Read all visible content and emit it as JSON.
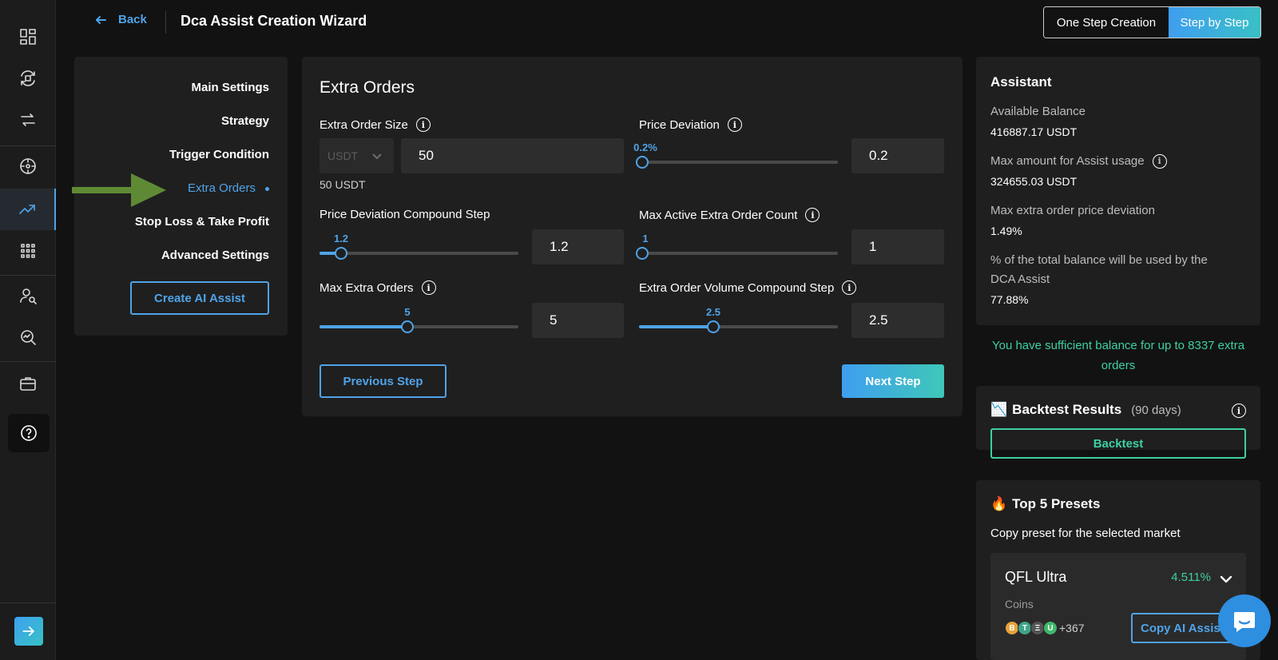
{
  "header": {
    "back_label": "Back",
    "title": "Dca Assist Creation Wizard",
    "mode_one": "One Step Creation",
    "mode_step": "Step by Step"
  },
  "rail": {
    "icons": [
      "dashboard-icon",
      "bots-cycle-icon",
      "swap-icon",
      "target-icon",
      "trending-icon",
      "grid-apps-icon",
      "user-search-icon",
      "analytics-search-icon",
      "briefcase-icon",
      "help-icon",
      "expand-arrow-icon"
    ]
  },
  "steps": {
    "items": [
      {
        "label": "Main Settings"
      },
      {
        "label": "Strategy"
      },
      {
        "label": "Trigger Condition"
      },
      {
        "label": "Extra Orders"
      },
      {
        "label": "Stop Loss & Take Profit"
      },
      {
        "label": "Advanced Settings"
      }
    ],
    "active_index": 3,
    "create_ai_label": "Create AI Assist"
  },
  "form": {
    "heading": "Extra Orders",
    "extra_order_size": {
      "label": "Extra Order Size",
      "currency": "USDT",
      "value": "50",
      "sub": "50 USDT"
    },
    "price_deviation": {
      "label": "Price Deviation",
      "slider_label": "0.2%",
      "value": "0.2",
      "fraction": 0.01
    },
    "compound_step": {
      "label": "Price Deviation Compound Step",
      "slider_label": "1.2",
      "value": "1.2",
      "fraction": 0.11
    },
    "max_active": {
      "label": "Max Active Extra Order Count",
      "slider_label": "1",
      "value": "1",
      "fraction": 0.0
    },
    "max_extra": {
      "label": "Max Extra Orders",
      "slider_label": "5",
      "value": "5",
      "fraction": 0.44
    },
    "volume_step": {
      "label": "Extra Order Volume Compound Step",
      "slider_label": "2.5",
      "value": "2.5",
      "fraction": 0.375
    },
    "prev_label": "Previous Step",
    "next_label": "Next Step"
  },
  "assistant": {
    "title": "Assistant",
    "available_label": "Available Balance",
    "available_value": "416887.17 USDT",
    "max_amount_label": "Max amount for Assist usage",
    "max_amount_value": "324655.03 USDT",
    "max_dev_label": "Max extra order price deviation",
    "max_dev_value": "1.49%",
    "pct_label_1": "% of the total balance will be used by the",
    "pct_label_2": "DCA Assist",
    "pct_value": "77.88%"
  },
  "sufficient": {
    "line1": "You have sufficient balance for up to 8337 extra",
    "line2": "orders"
  },
  "backtest": {
    "emoji": "📉",
    "title": "Backtest Results",
    "days": "(90 days)",
    "button": "Backtest"
  },
  "presets": {
    "emoji": "🔥",
    "title": "Top 5 Presets",
    "desc": "Copy preset for the selected market",
    "card": {
      "name": "QFL Ultra",
      "pct": "4.511%",
      "coins_label": "Coins",
      "more": "+367",
      "copy_label": "Copy AI Assist"
    }
  },
  "colors": {
    "accent_blue": "#4fa3e8",
    "accent_green": "#3ecfa4",
    "bg": "#121212",
    "panel": "#1f1f1f"
  }
}
